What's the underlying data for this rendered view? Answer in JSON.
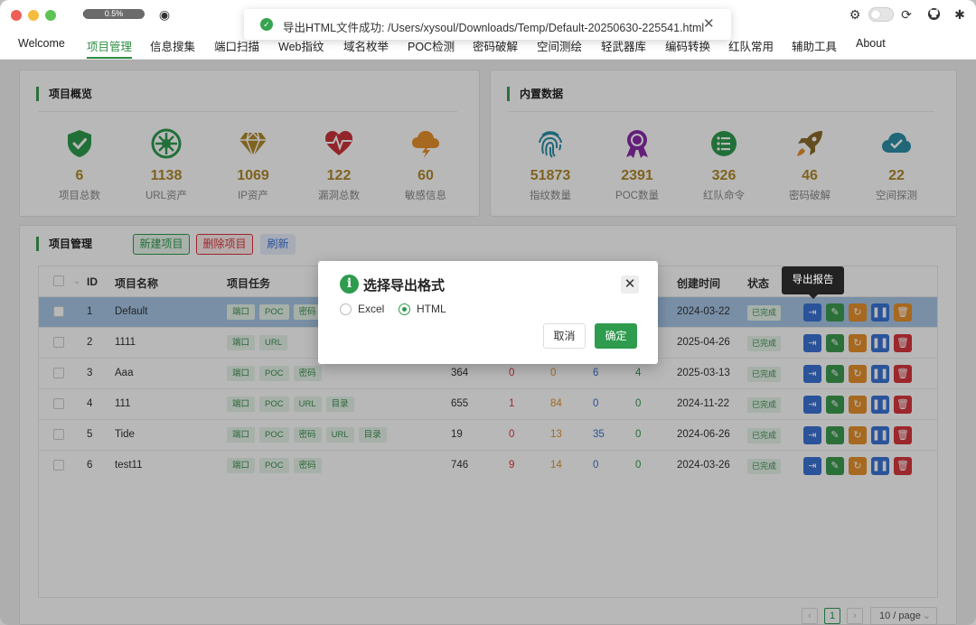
{
  "titlebar": {
    "progress_label": "0.5%",
    "progress_value": 0.005
  },
  "toast": {
    "message": "导出HTML文件成功: /Users/xysoul/Downloads/Temp/Default-20250630-225541.html"
  },
  "menu": [
    "Welcome",
    "项目管理",
    "信息搜集",
    "端口扫描",
    "Web指纹",
    "域名枚举",
    "POC检测",
    "密码破解",
    "空间测绘",
    "轻武器库",
    "编码转换",
    "红队常用",
    "辅助工具",
    "About"
  ],
  "overview": {
    "title": "项目概览",
    "stats": [
      {
        "value": "6",
        "label": "项目总数",
        "icon": "shield-check-icon"
      },
      {
        "value": "1138",
        "label": "URL资产",
        "icon": "network-hub-icon"
      },
      {
        "value": "1069",
        "label": "IP资产",
        "icon": "diamond-icon"
      },
      {
        "value": "122",
        "label": "漏洞总数",
        "icon": "heartbeat-icon"
      },
      {
        "value": "60",
        "label": "敏感信息",
        "icon": "storm-cloud-icon"
      }
    ]
  },
  "builtin": {
    "title": "内置数据",
    "stats": [
      {
        "value": "51873",
        "label": "指纹数量",
        "icon": "fingerprint-icon"
      },
      {
        "value": "2391",
        "label": "POC数量",
        "icon": "award-ribbon-icon"
      },
      {
        "value": "326",
        "label": "红队命令",
        "icon": "list-icon"
      },
      {
        "value": "46",
        "label": "密码破解",
        "icon": "rocket-icon"
      },
      {
        "value": "22",
        "label": "空间探测",
        "icon": "cloud-check-icon"
      }
    ]
  },
  "projects": {
    "title": "项目管理",
    "new_label": "新建项目",
    "delete_label": "删除项目",
    "refresh_label": "刷新",
    "columns": {
      "id": "ID",
      "name": "项目名称",
      "tasks": "项目任务",
      "created": "创建时间",
      "status": "状态"
    },
    "rows": [
      {
        "id": "1",
        "name": "Default",
        "tags": [
          "端口",
          "POC",
          "密码"
        ],
        "c1": "",
        "c2": "",
        "c3": "",
        "c4": "",
        "c5": "",
        "created": "2024-03-22",
        "status": "已完成"
      },
      {
        "id": "2",
        "name": "1111",
        "tags": [
          "端口",
          "URL"
        ],
        "c1": "",
        "c2": "",
        "c3": "",
        "c4": "",
        "c5": "",
        "created": "2025-04-26",
        "status": "已完成"
      },
      {
        "id": "3",
        "name": "Aaa",
        "tags": [
          "端口",
          "POC",
          "密码"
        ],
        "c1": "364",
        "c2": "0",
        "c3": "0",
        "c4": "6",
        "c5": "4",
        "created": "2025-03-13",
        "status": "已完成"
      },
      {
        "id": "4",
        "name": "111",
        "tags": [
          "端口",
          "POC",
          "URL",
          "目录"
        ],
        "c1": "655",
        "c2": "1",
        "c3": "84",
        "c4": "0",
        "c5": "0",
        "created": "2024-11-22",
        "status": "已完成"
      },
      {
        "id": "5",
        "name": "Tide",
        "tags": [
          "端口",
          "POC",
          "密码",
          "URL",
          "目录"
        ],
        "c1": "19",
        "c2": "0",
        "c3": "13",
        "c4": "35",
        "c5": "0",
        "created": "2024-06-26",
        "status": "已完成"
      },
      {
        "id": "6",
        "name": "test11",
        "tags": [
          "端口",
          "POC",
          "密码"
        ],
        "c1": "746",
        "c2": "9",
        "c3": "14",
        "c4": "0",
        "c5": "0",
        "created": "2024-03-26",
        "status": "已完成"
      }
    ]
  },
  "tooltip": "导出报告",
  "dialog": {
    "title": "选择导出格式",
    "option_excel": "Excel",
    "option_html": "HTML",
    "selected": "HTML",
    "cancel": "取消",
    "confirm": "确定"
  },
  "pagination": {
    "page": "1",
    "page_size": "10 / page"
  },
  "colors": {
    "accent": "#3e9b50",
    "danger": "#d9363e",
    "blue": "#3b73d6",
    "orange": "#e8902c",
    "gold": "#b08a2b"
  }
}
